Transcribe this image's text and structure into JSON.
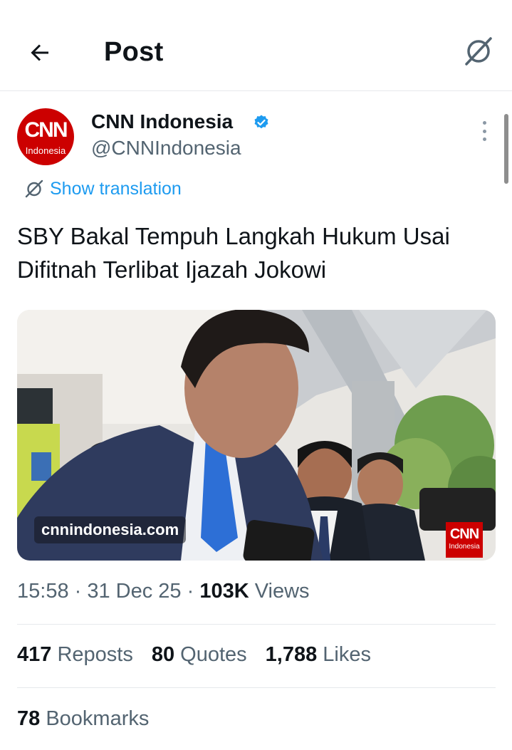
{
  "header": {
    "title": "Post",
    "back_icon": "arrow-left-icon",
    "translate_icon": "translate-icon"
  },
  "author": {
    "name": "CNN Indonesia",
    "handle": "@CNNIndonesia",
    "verified": true,
    "avatar_logo": "CNN",
    "avatar_sub": "Indonesia"
  },
  "show_translation": "Show translation",
  "post": {
    "text": "SBY Bakal Tempuh Langkah Hukum Usai Difitnah Terlibat Ijazah Jokowi"
  },
  "media": {
    "url_overlay": "cnnindonesia.com",
    "logo_text": "CNN",
    "logo_sub": "Indonesia"
  },
  "meta": {
    "time": "15:58",
    "sep1": " · ",
    "date": "31 Dec 25",
    "sep2": " · ",
    "views_count": "103K",
    "views_label": " Views"
  },
  "stats": {
    "reposts": {
      "count": "417",
      "label": " Reposts"
    },
    "quotes": {
      "count": "80",
      "label": " Quotes"
    },
    "likes": {
      "count": "1,788",
      "label": " Likes"
    },
    "bookmarks": {
      "count": "78",
      "label": " Bookmarks"
    }
  },
  "colors": {
    "accent": "#1d9bf0",
    "brand_red": "#cc0000",
    "secondary_text": "#536471"
  }
}
